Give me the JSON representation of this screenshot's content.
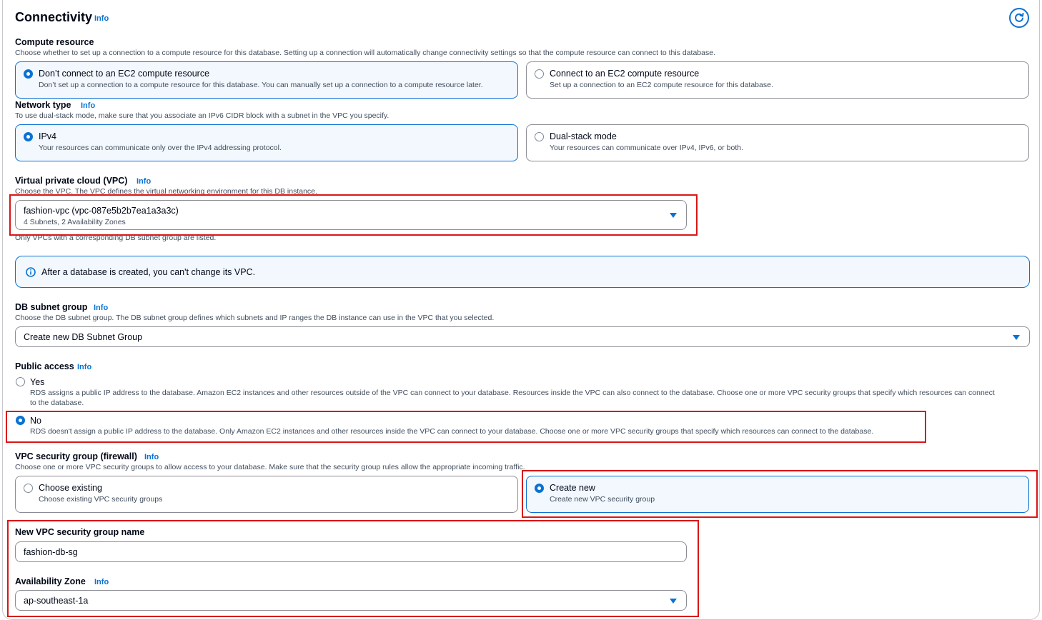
{
  "header": {
    "title": "Connectivity",
    "info": "Info",
    "refresh_icon": "refresh-icon"
  },
  "compute": {
    "label": "Compute resource",
    "desc": "Choose whether to set up a connection to a compute resource for this database. Setting up a connection will automatically change connectivity settings so that the compute resource can connect to this database.",
    "options": [
      {
        "label": "Don’t connect to an EC2 compute resource",
        "desc": "Don’t set up a connection to a compute resource for this database. You can manually set up a connection to a compute resource later.",
        "selected": true
      },
      {
        "label": "Connect to an EC2 compute resource",
        "desc": "Set up a connection to an EC2 compute resource for this database.",
        "selected": false
      }
    ]
  },
  "network": {
    "label": "Network type",
    "info": "Info",
    "desc": "To use dual-stack mode, make sure that you associate an IPv6 CIDR block with a subnet in the VPC you specify.",
    "options": [
      {
        "label": "IPv4",
        "desc": "Your resources can communicate only over the IPv4 addressing protocol.",
        "selected": true
      },
      {
        "label": "Dual-stack mode",
        "desc": "Your resources can communicate over IPv4, IPv6, or both.",
        "selected": false
      }
    ]
  },
  "vpc": {
    "label": "Virtual private cloud (VPC)",
    "info": "Info",
    "desc": "Choose the VPC. The VPC defines the virtual networking environment for this DB instance.",
    "value": "fashion-vpc (vpc-087e5b2b7ea1a3a3c)",
    "sub": "4 Subnets, 2 Availability Zones",
    "hint": "Only VPCs with a corresponding DB subnet group are listed."
  },
  "vpc_alert": {
    "text": "After a database is created, you can't change its VPC.",
    "icon": "info-circle-icon"
  },
  "subnet": {
    "label": "DB subnet group",
    "info": "Info",
    "desc": "Choose the DB subnet group. The DB subnet group defines which subnets and IP ranges the DB instance can use in the VPC that you selected.",
    "value": "Create new DB Subnet Group"
  },
  "public": {
    "label": "Public access",
    "info": "Info",
    "options": [
      {
        "label": "Yes",
        "desc": "RDS assigns a public IP address to the database. Amazon EC2 instances and other resources outside of the VPC can connect to your database. Resources inside the VPC can also connect to the database. Choose one or more VPC security groups that specify which resources can connect",
        "desc2": "to the database.",
        "selected": false
      },
      {
        "label": "No",
        "desc": "RDS doesn't assign a public IP address to the database. Only Amazon EC2 instances and other resources inside the VPC can connect to your database. Choose one or more VPC security groups that specify which resources can connect to the database.",
        "selected": true
      }
    ]
  },
  "sg": {
    "label": "VPC security group (firewall)",
    "info": "Info",
    "desc": "Choose one or more VPC security groups to allow access to your database. Make sure that the security group rules allow the appropriate incoming traffic.",
    "options": [
      {
        "label": "Choose existing",
        "desc": "Choose existing VPC security groups",
        "selected": false
      },
      {
        "label": "Create new",
        "desc": "Create new VPC security group",
        "selected": true
      }
    ]
  },
  "sg_name": {
    "label": "New VPC security group name",
    "value": "fashion-db-sg"
  },
  "az": {
    "label": "Availability Zone",
    "info": "Info",
    "value": "ap-southeast-1a"
  },
  "colors": {
    "accent": "#0972d3",
    "highlight": "#d91515",
    "text": "#000716",
    "muted": "#414d5c"
  }
}
